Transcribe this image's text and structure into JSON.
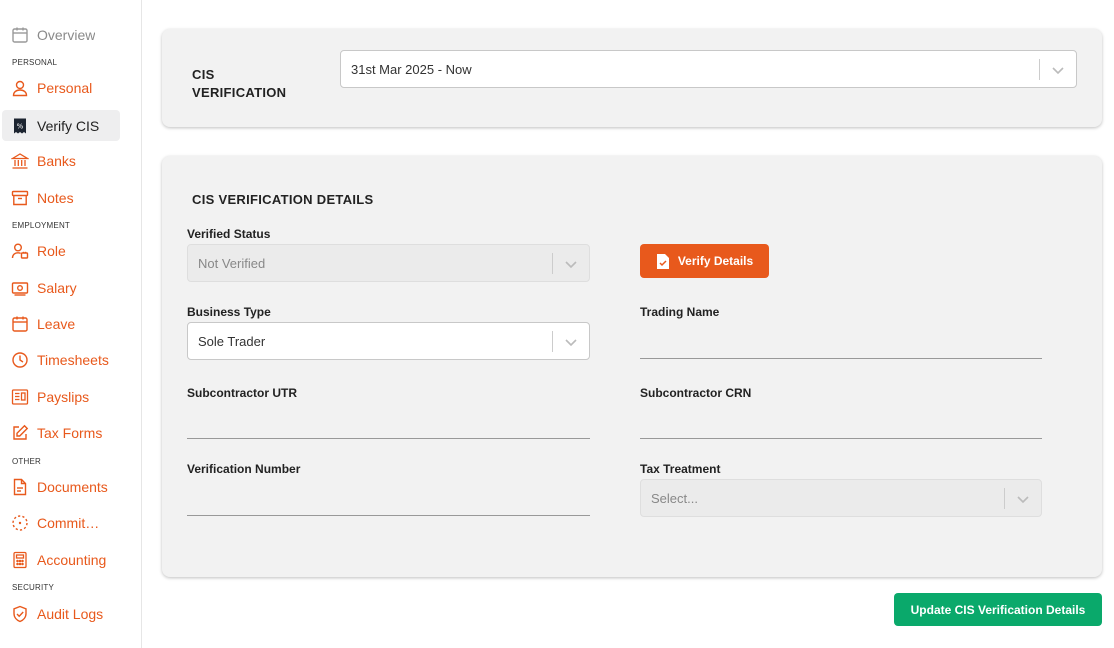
{
  "sidebar": {
    "items": [
      {
        "label": "Overview",
        "icon": "calendar-icon"
      },
      {
        "label": "Personal",
        "icon": "person-icon"
      },
      {
        "label": "Verify CIS",
        "icon": "receipt-icon"
      },
      {
        "label": "Banks",
        "icon": "bank-icon"
      },
      {
        "label": "Notes",
        "icon": "archive-icon"
      },
      {
        "label": "Role",
        "icon": "user-role-icon"
      },
      {
        "label": "Salary",
        "icon": "banknote-icon"
      },
      {
        "label": "Leave",
        "icon": "calendar-icon"
      },
      {
        "label": "Timesheets",
        "icon": "clock-icon"
      },
      {
        "label": "Payslips",
        "icon": "payslip-icon"
      },
      {
        "label": "Tax Forms",
        "icon": "edit-icon"
      },
      {
        "label": "Documents",
        "icon": "document-icon"
      },
      {
        "label": "Commit…",
        "icon": "commitment-icon"
      },
      {
        "label": "Accounting",
        "icon": "calculator-icon"
      },
      {
        "label": "Audit Logs",
        "icon": "shield-check-icon"
      }
    ],
    "sections": {
      "personal": "PERSONAL",
      "employment": "EMPLOYMENT",
      "other": "OTHER",
      "security": "SECURITY"
    }
  },
  "cis_card": {
    "title": "CIS VERIFICATION",
    "period_select": "31st Mar 2025 - Now"
  },
  "details": {
    "title": "CIS VERIFICATION DETAILS",
    "verified_status_label": "Verified Status",
    "verified_status_value": "Not Verified",
    "verify_button": "Verify Details",
    "business_type_label": "Business Type",
    "business_type_value": "Sole Trader",
    "trading_name_label": "Trading Name",
    "trading_name_value": "",
    "utr_label": "Subcontractor UTR",
    "utr_value": "",
    "crn_label": "Subcontractor CRN",
    "crn_value": "",
    "verification_number_label": "Verification Number",
    "verification_number_value": "",
    "tax_treatment_label": "Tax Treatment",
    "tax_treatment_placeholder": "Select..."
  },
  "update_button": "Update CIS Verification Details",
  "colors": {
    "accent": "#e8591c",
    "success": "#0aa96b"
  }
}
